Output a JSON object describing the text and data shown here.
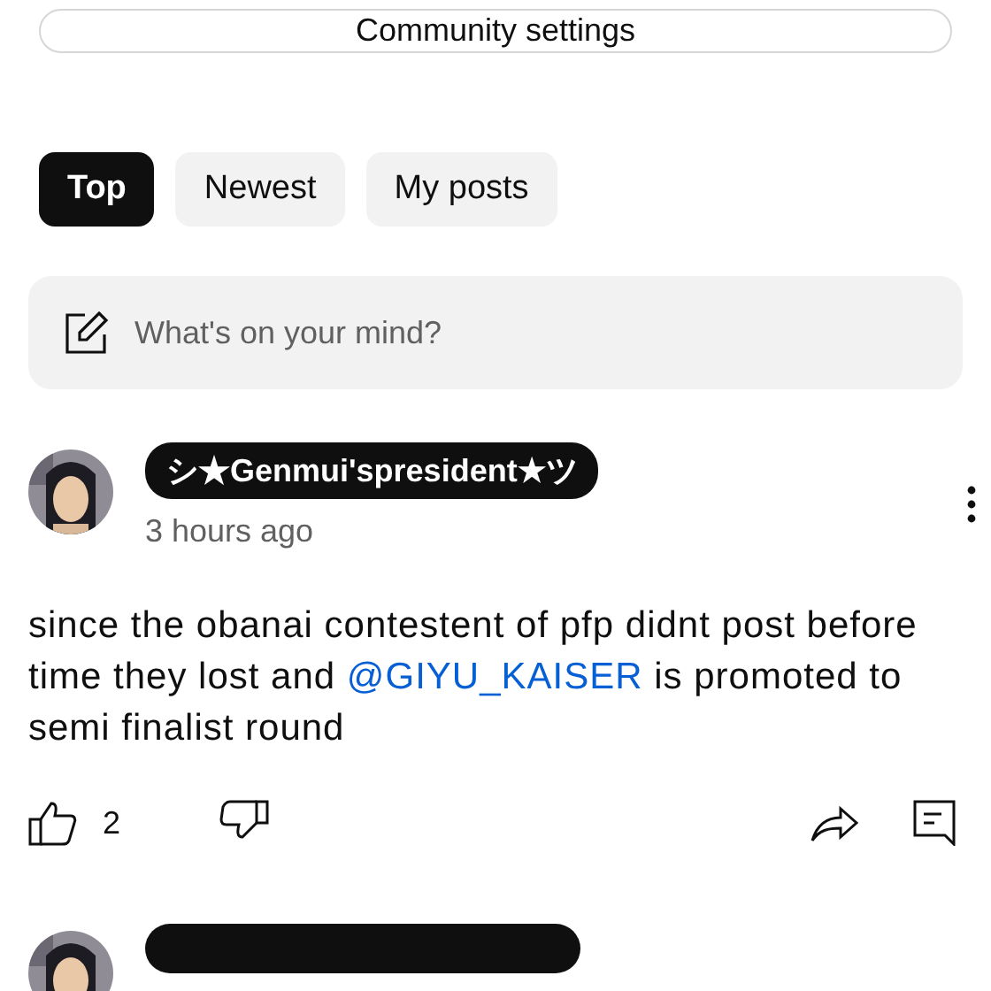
{
  "settings_button": {
    "label": "Community settings"
  },
  "tabs": [
    {
      "label": "Top",
      "selected": true
    },
    {
      "label": "Newest",
      "selected": false
    },
    {
      "label": "My posts",
      "selected": false
    }
  ],
  "composer": {
    "placeholder": "What's on your mind?"
  },
  "posts": [
    {
      "author": "シ★Genmui'spresident★ツ",
      "time": "3 hours ago",
      "body": "since the obanai contestent of pfp didnt post before time they lost and ",
      "mention": "@GIYU_KAISER",
      "body_end": " is promoted to semi finalist round",
      "likes": "2"
    }
  ]
}
